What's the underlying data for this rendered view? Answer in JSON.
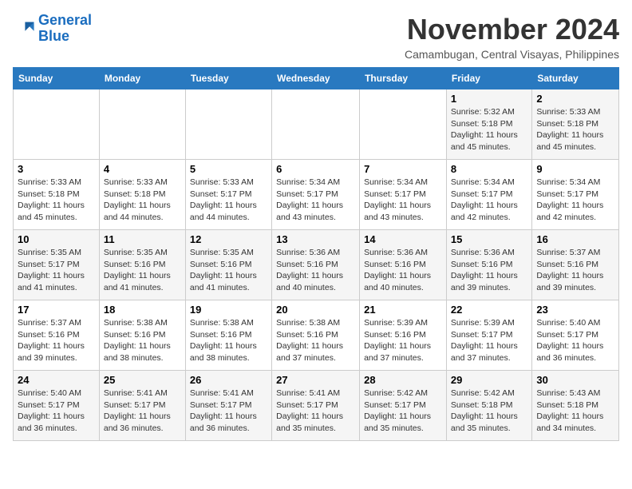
{
  "logo": {
    "line1": "General",
    "line2": "Blue"
  },
  "title": "November 2024",
  "subtitle": "Camambugan, Central Visayas, Philippines",
  "weekdays": [
    "Sunday",
    "Monday",
    "Tuesday",
    "Wednesday",
    "Thursday",
    "Friday",
    "Saturday"
  ],
  "weeks": [
    [
      {
        "day": "",
        "info": ""
      },
      {
        "day": "",
        "info": ""
      },
      {
        "day": "",
        "info": ""
      },
      {
        "day": "",
        "info": ""
      },
      {
        "day": "",
        "info": ""
      },
      {
        "day": "1",
        "info": "Sunrise: 5:32 AM\nSunset: 5:18 PM\nDaylight: 11 hours\nand 45 minutes."
      },
      {
        "day": "2",
        "info": "Sunrise: 5:33 AM\nSunset: 5:18 PM\nDaylight: 11 hours\nand 45 minutes."
      }
    ],
    [
      {
        "day": "3",
        "info": "Sunrise: 5:33 AM\nSunset: 5:18 PM\nDaylight: 11 hours\nand 45 minutes."
      },
      {
        "day": "4",
        "info": "Sunrise: 5:33 AM\nSunset: 5:18 PM\nDaylight: 11 hours\nand 44 minutes."
      },
      {
        "day": "5",
        "info": "Sunrise: 5:33 AM\nSunset: 5:17 PM\nDaylight: 11 hours\nand 44 minutes."
      },
      {
        "day": "6",
        "info": "Sunrise: 5:34 AM\nSunset: 5:17 PM\nDaylight: 11 hours\nand 43 minutes."
      },
      {
        "day": "7",
        "info": "Sunrise: 5:34 AM\nSunset: 5:17 PM\nDaylight: 11 hours\nand 43 minutes."
      },
      {
        "day": "8",
        "info": "Sunrise: 5:34 AM\nSunset: 5:17 PM\nDaylight: 11 hours\nand 42 minutes."
      },
      {
        "day": "9",
        "info": "Sunrise: 5:34 AM\nSunset: 5:17 PM\nDaylight: 11 hours\nand 42 minutes."
      }
    ],
    [
      {
        "day": "10",
        "info": "Sunrise: 5:35 AM\nSunset: 5:17 PM\nDaylight: 11 hours\nand 41 minutes."
      },
      {
        "day": "11",
        "info": "Sunrise: 5:35 AM\nSunset: 5:16 PM\nDaylight: 11 hours\nand 41 minutes."
      },
      {
        "day": "12",
        "info": "Sunrise: 5:35 AM\nSunset: 5:16 PM\nDaylight: 11 hours\nand 41 minutes."
      },
      {
        "day": "13",
        "info": "Sunrise: 5:36 AM\nSunset: 5:16 PM\nDaylight: 11 hours\nand 40 minutes."
      },
      {
        "day": "14",
        "info": "Sunrise: 5:36 AM\nSunset: 5:16 PM\nDaylight: 11 hours\nand 40 minutes."
      },
      {
        "day": "15",
        "info": "Sunrise: 5:36 AM\nSunset: 5:16 PM\nDaylight: 11 hours\nand 39 minutes."
      },
      {
        "day": "16",
        "info": "Sunrise: 5:37 AM\nSunset: 5:16 PM\nDaylight: 11 hours\nand 39 minutes."
      }
    ],
    [
      {
        "day": "17",
        "info": "Sunrise: 5:37 AM\nSunset: 5:16 PM\nDaylight: 11 hours\nand 39 minutes."
      },
      {
        "day": "18",
        "info": "Sunrise: 5:38 AM\nSunset: 5:16 PM\nDaylight: 11 hours\nand 38 minutes."
      },
      {
        "day": "19",
        "info": "Sunrise: 5:38 AM\nSunset: 5:16 PM\nDaylight: 11 hours\nand 38 minutes."
      },
      {
        "day": "20",
        "info": "Sunrise: 5:38 AM\nSunset: 5:16 PM\nDaylight: 11 hours\nand 37 minutes."
      },
      {
        "day": "21",
        "info": "Sunrise: 5:39 AM\nSunset: 5:16 PM\nDaylight: 11 hours\nand 37 minutes."
      },
      {
        "day": "22",
        "info": "Sunrise: 5:39 AM\nSunset: 5:17 PM\nDaylight: 11 hours\nand 37 minutes."
      },
      {
        "day": "23",
        "info": "Sunrise: 5:40 AM\nSunset: 5:17 PM\nDaylight: 11 hours\nand 36 minutes."
      }
    ],
    [
      {
        "day": "24",
        "info": "Sunrise: 5:40 AM\nSunset: 5:17 PM\nDaylight: 11 hours\nand 36 minutes."
      },
      {
        "day": "25",
        "info": "Sunrise: 5:41 AM\nSunset: 5:17 PM\nDaylight: 11 hours\nand 36 minutes."
      },
      {
        "day": "26",
        "info": "Sunrise: 5:41 AM\nSunset: 5:17 PM\nDaylight: 11 hours\nand 36 minutes."
      },
      {
        "day": "27",
        "info": "Sunrise: 5:41 AM\nSunset: 5:17 PM\nDaylight: 11 hours\nand 35 minutes."
      },
      {
        "day": "28",
        "info": "Sunrise: 5:42 AM\nSunset: 5:17 PM\nDaylight: 11 hours\nand 35 minutes."
      },
      {
        "day": "29",
        "info": "Sunrise: 5:42 AM\nSunset: 5:18 PM\nDaylight: 11 hours\nand 35 minutes."
      },
      {
        "day": "30",
        "info": "Sunrise: 5:43 AM\nSunset: 5:18 PM\nDaylight: 11 hours\nand 34 minutes."
      }
    ]
  ]
}
